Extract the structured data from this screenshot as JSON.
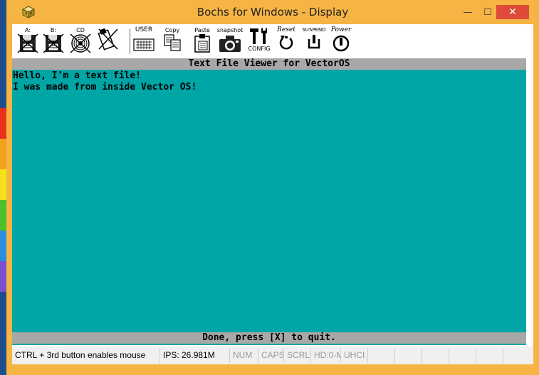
{
  "window": {
    "title": "Bochs for Windows - Display",
    "minimize_glyph": "—",
    "maximize_glyph": "☐",
    "close_glyph": "✕"
  },
  "toolbar": {
    "items": [
      {
        "label": "A:",
        "icon": "floppy-a-icon"
      },
      {
        "label": "B:",
        "icon": "floppy-b-icon"
      },
      {
        "label": "CD",
        "icon": "cdrom-icon"
      },
      {
        "label": "",
        "icon": "usb-icon"
      },
      {
        "label": "USER",
        "icon": "keyboard-icon"
      },
      {
        "label": "Copy",
        "icon": "copy-icon"
      },
      {
        "label": "Paste",
        "icon": "paste-icon"
      },
      {
        "label": "snapshot",
        "icon": "camera-icon"
      },
      {
        "label": "CONFIG",
        "icon": "config-icon"
      },
      {
        "label": "Reset",
        "icon": "reset-icon"
      },
      {
        "label": "SUSPEND",
        "icon": "suspend-icon"
      },
      {
        "label": "Power",
        "icon": "power-icon"
      }
    ]
  },
  "screen": {
    "title": "Text File Viewer for VectorOS",
    "lines": [
      "Hello, I'm a text file!",
      "I was made from inside Vector OS!"
    ],
    "footer": "Done, press [X] to quit.",
    "background": "#00a6a6"
  },
  "statusbar": {
    "mouse_hint": "CTRL + 3rd button enables mouse",
    "ips": "IPS: 26.981M",
    "num": "NUM",
    "caps": "CAPS",
    "scrl": "SCRL",
    "hd": "HD:0-M",
    "uhci": "UHCI"
  },
  "colors": {
    "frame": "#f5b443",
    "close_button": "#e04a3a",
    "screen_bar": "#a8a8a8"
  }
}
